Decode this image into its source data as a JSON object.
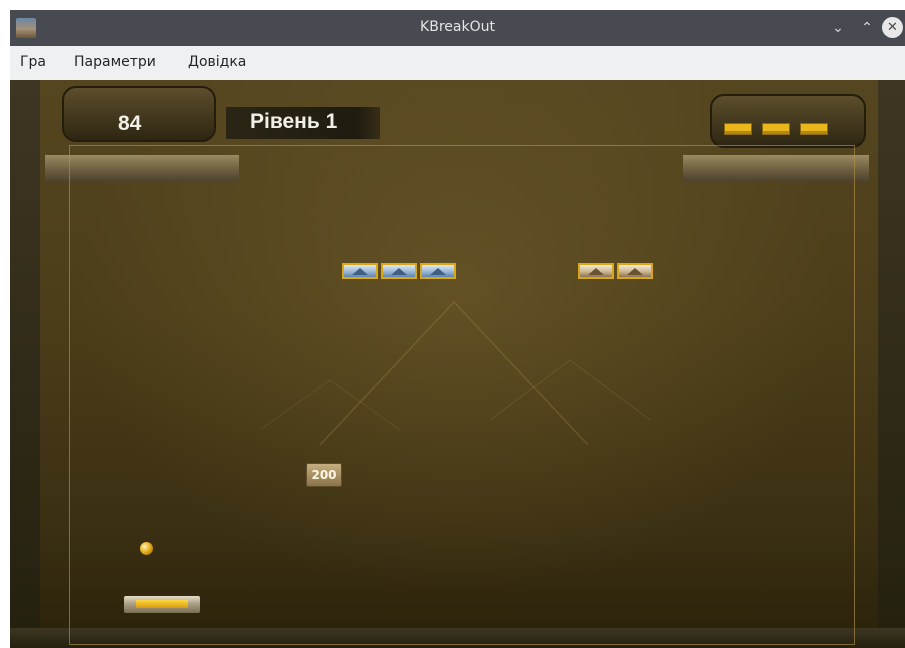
{
  "window": {
    "title": "KBreakOut",
    "icons": {
      "app": "kbreakout-app-icon",
      "minimize": "chevron-down-icon",
      "maximize": "chevron-up-icon",
      "close": "close-circle-icon"
    }
  },
  "menu": {
    "items": [
      {
        "label": "Гра"
      },
      {
        "label": "Параметри"
      },
      {
        "label": "Довідка"
      }
    ]
  },
  "game": {
    "score": "84",
    "level_label": "Рівень 1",
    "lives": 3,
    "bricks": [
      {
        "style": "blue-pyramid"
      },
      {
        "style": "blue-pyramid"
      },
      {
        "style": "blue-pyramid"
      },
      {
        "style": "sand-pyramid"
      },
      {
        "style": "sand-pyramid"
      }
    ],
    "bonus_value": "200",
    "colors": {
      "background": "#4c3e1a",
      "brick_border": "#d9a81a",
      "paddle_bar": "#f3c42a",
      "ball": "#e8b020"
    }
  }
}
